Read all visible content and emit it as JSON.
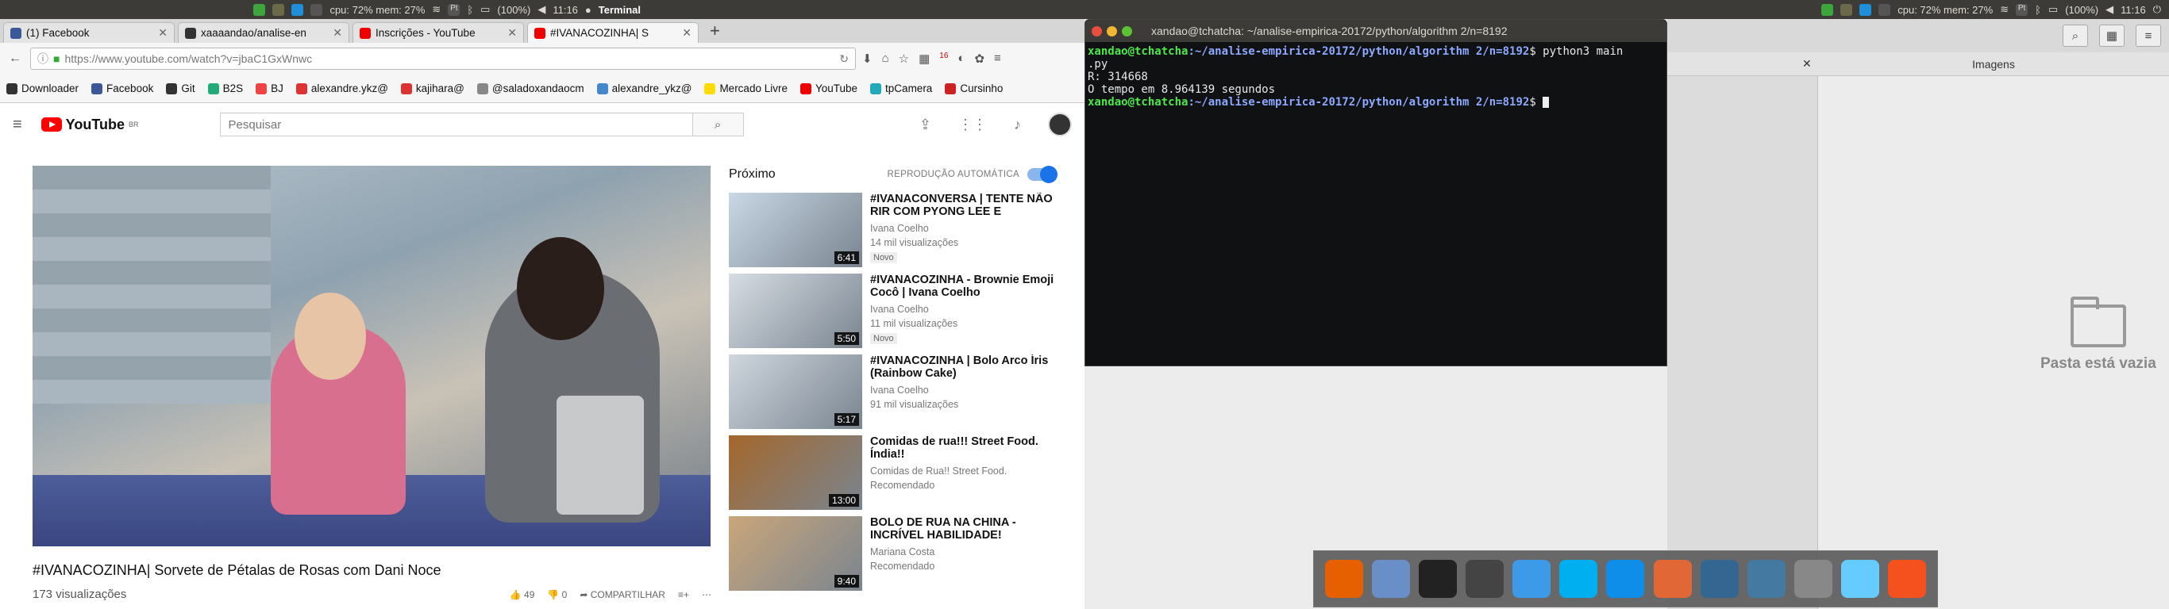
{
  "panel": {
    "cpu": "cpu: 72% mem: 27%",
    "battery": "(100%)",
    "time": "11:16",
    "terminal_title": "Terminal"
  },
  "browser": {
    "tabs": [
      {
        "label": "(1) Facebook",
        "color": "#3b5998"
      },
      {
        "label": "xaaaandao/analise-en",
        "color": "#333"
      },
      {
        "label": "Inscrições - YouTube",
        "color": "#e00"
      },
      {
        "label": "#IVANACOZINHA| S",
        "color": "#e00"
      }
    ],
    "url": "https://www.youtube.com/watch?v=jbaC1GxWnwc",
    "bookmarks": [
      {
        "label": "Downloader",
        "color": "#333"
      },
      {
        "label": "Facebook",
        "color": "#3b5998"
      },
      {
        "label": "Git",
        "color": "#333"
      },
      {
        "label": "B2S",
        "color": "#2a7"
      },
      {
        "label": "BJ",
        "color": "#e44"
      },
      {
        "label": "alexandre.ykz@",
        "color": "#d33"
      },
      {
        "label": "kajihara@",
        "color": "#d33"
      },
      {
        "label": "@saladoxandaocm",
        "color": "#888"
      },
      {
        "label": "alexandre_ykz@",
        "color": "#48c"
      },
      {
        "label": "Mercado Livre",
        "color": "#fd0"
      },
      {
        "label": "YouTube",
        "color": "#e00"
      },
      {
        "label": "tpCamera",
        "color": "#2ab"
      },
      {
        "label": "Cursinho",
        "color": "#c22"
      }
    ],
    "badge": "16"
  },
  "youtube": {
    "logo": "YouTube",
    "logo_sup": "BR",
    "search_placeholder": "Pesquisar",
    "video_title": "#IVANACOZINHA| Sorvete de Pétalas de Rosas com Dani Noce",
    "views": "173 visualizações",
    "likes": "49",
    "dislikes": "0",
    "share": "COMPARTILHAR",
    "up_next": "Próximo",
    "autoplay": "REPRODUÇÃO AUTOMÁTICA",
    "cards": [
      {
        "title": "#IVANACONVERSA | TENTE NÃO RIR COM PYONG LEE E",
        "channel": "Ivana Coelho",
        "views": "14 mil visualizações",
        "badge": "Novo",
        "duration": "6:41",
        "color": "#c9d8e6"
      },
      {
        "title": "#IVANACOZINHA - Brownie Emoji Cocô | Ivana Coelho",
        "channel": "Ivana Coelho",
        "views": "11 mil visualizações",
        "badge": "Novo",
        "duration": "5:50",
        "color": "#d7dde4"
      },
      {
        "title": "#IVANACOZINHA | Bolo Arco Íris (Rainbow Cake)",
        "channel": "Ivana Coelho",
        "views": "91 mil visualizações",
        "badge": "",
        "duration": "5:17",
        "color": "#cfd6de"
      },
      {
        "title": "Comidas de rua!!! Street Food. Índia!!",
        "channel": "Comidas de Rua!! Street Food.",
        "views": "Recomendado",
        "badge": "",
        "duration": "13:00",
        "color": "#a4672c"
      },
      {
        "title": "BOLO DE RUA NA CHINA - INCRÍVEL HABILIDADE!",
        "channel": "Mariana Costa",
        "views": "Recomendado",
        "badge": "",
        "duration": "9:40",
        "color": "#caa67a"
      }
    ]
  },
  "terminal": {
    "title": "xandao@tchatcha: ~/analise-empirica-20172/python/algorithm 2/n=8192",
    "user": "xandao@tchatcha",
    "path": ":~/analise-empirica-20172/python/algorithm 2/n=8192",
    "cmd": "$ python3 main",
    "cmd_wrap": ".py",
    "out1": "R: 314668",
    "out2": "O tempo em 8.964139 segundos",
    "prompt2": "$ "
  },
  "files": {
    "tab_images": "Imagens",
    "empty_text": "Pasta está vazia"
  },
  "dock": [
    {
      "name": "firefox",
      "color": "#e66000"
    },
    {
      "name": "files",
      "color": "#6a8ec8"
    },
    {
      "name": "terminal",
      "color": "#222"
    },
    {
      "name": "sublime",
      "color": "#444"
    },
    {
      "name": "dropbox",
      "color": "#3d9ae8"
    },
    {
      "name": "skype",
      "color": "#00aff0"
    },
    {
      "name": "teamviewer",
      "color": "#0e8ee9"
    },
    {
      "name": "matlab",
      "color": "#e16737"
    },
    {
      "name": "postgres",
      "color": "#336791"
    },
    {
      "name": "mysql",
      "color": "#4479a1"
    },
    {
      "name": "remote",
      "color": "#888"
    },
    {
      "name": "virtualbox",
      "color": "#6cf"
    },
    {
      "name": "gitkraken",
      "color": "#f4511e"
    }
  ]
}
